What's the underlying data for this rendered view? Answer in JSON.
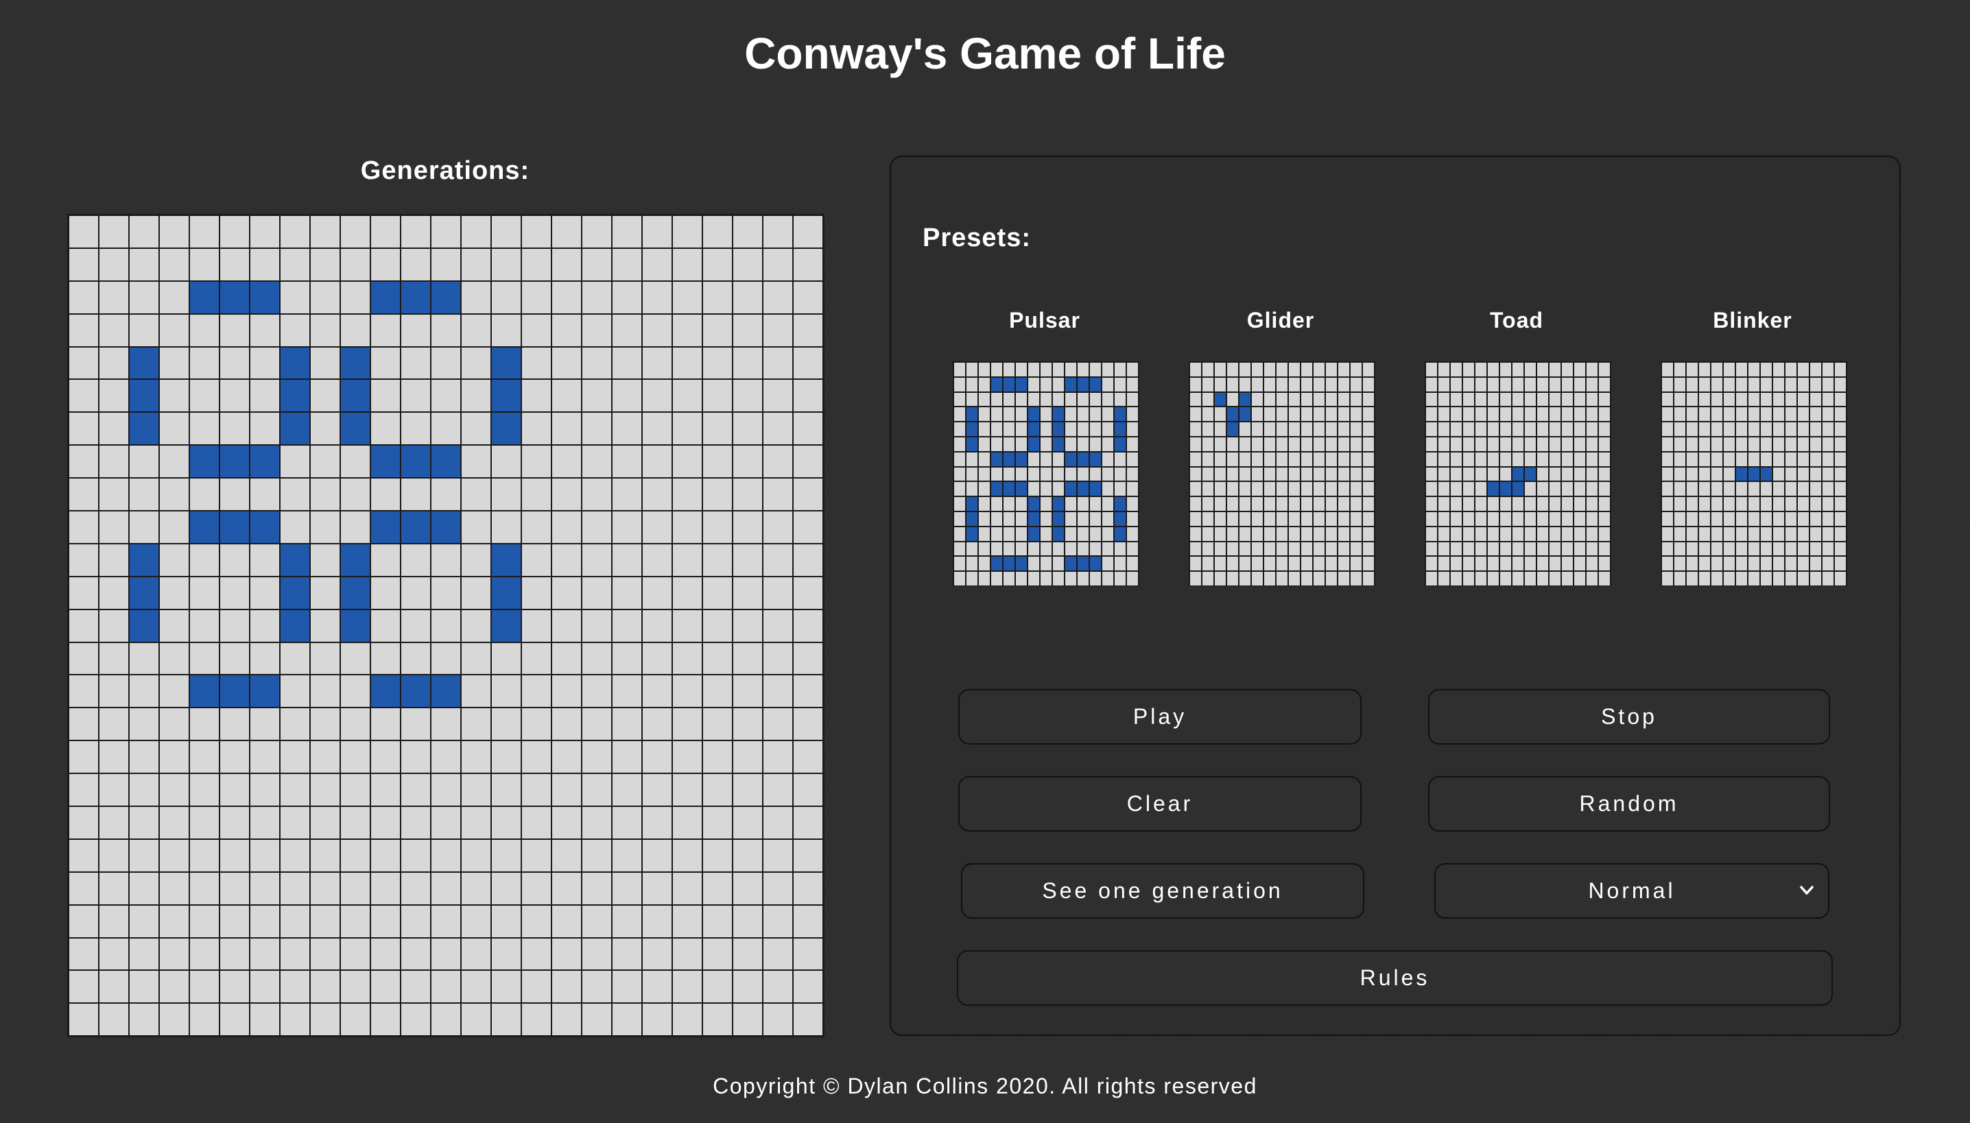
{
  "page": {
    "title": "Conway's Game of Life",
    "footer": "Copyright © Dylan Collins 2020. All rights reserved"
  },
  "board": {
    "label": "Generations:",
    "rows": 25,
    "cols": 25,
    "alive_cells": [
      [
        2,
        4
      ],
      [
        2,
        5
      ],
      [
        2,
        6
      ],
      [
        2,
        10
      ],
      [
        2,
        11
      ],
      [
        2,
        12
      ],
      [
        4,
        2
      ],
      [
        4,
        7
      ],
      [
        4,
        9
      ],
      [
        4,
        14
      ],
      [
        5,
        2
      ],
      [
        5,
        7
      ],
      [
        5,
        9
      ],
      [
        5,
        14
      ],
      [
        6,
        2
      ],
      [
        6,
        7
      ],
      [
        6,
        9
      ],
      [
        6,
        14
      ],
      [
        7,
        4
      ],
      [
        7,
        5
      ],
      [
        7,
        6
      ],
      [
        7,
        10
      ],
      [
        7,
        11
      ],
      [
        7,
        12
      ],
      [
        9,
        4
      ],
      [
        9,
        5
      ],
      [
        9,
        6
      ],
      [
        9,
        10
      ],
      [
        9,
        11
      ],
      [
        9,
        12
      ],
      [
        10,
        2
      ],
      [
        10,
        7
      ],
      [
        10,
        9
      ],
      [
        10,
        14
      ],
      [
        11,
        2
      ],
      [
        11,
        7
      ],
      [
        11,
        9
      ],
      [
        11,
        14
      ],
      [
        12,
        2
      ],
      [
        12,
        7
      ],
      [
        12,
        9
      ],
      [
        12,
        14
      ],
      [
        14,
        4
      ],
      [
        14,
        5
      ],
      [
        14,
        6
      ],
      [
        14,
        10
      ],
      [
        14,
        11
      ],
      [
        14,
        12
      ]
    ]
  },
  "presets": {
    "label": "Presets:",
    "items": [
      {
        "name": "Pulsar",
        "rows": 15,
        "cols": 15,
        "alive_cells": [
          [
            1,
            3
          ],
          [
            1,
            4
          ],
          [
            1,
            5
          ],
          [
            1,
            9
          ],
          [
            1,
            10
          ],
          [
            1,
            11
          ],
          [
            3,
            1
          ],
          [
            3,
            6
          ],
          [
            3,
            8
          ],
          [
            3,
            13
          ],
          [
            4,
            1
          ],
          [
            4,
            6
          ],
          [
            4,
            8
          ],
          [
            4,
            13
          ],
          [
            5,
            1
          ],
          [
            5,
            6
          ],
          [
            5,
            8
          ],
          [
            5,
            13
          ],
          [
            6,
            3
          ],
          [
            6,
            4
          ],
          [
            6,
            5
          ],
          [
            6,
            9
          ],
          [
            6,
            10
          ],
          [
            6,
            11
          ],
          [
            8,
            3
          ],
          [
            8,
            4
          ],
          [
            8,
            5
          ],
          [
            8,
            9
          ],
          [
            8,
            10
          ],
          [
            8,
            11
          ],
          [
            9,
            1
          ],
          [
            9,
            6
          ],
          [
            9,
            8
          ],
          [
            9,
            13
          ],
          [
            10,
            1
          ],
          [
            10,
            6
          ],
          [
            10,
            8
          ],
          [
            10,
            13
          ],
          [
            11,
            1
          ],
          [
            11,
            6
          ],
          [
            11,
            8
          ],
          [
            11,
            13
          ],
          [
            13,
            3
          ],
          [
            13,
            4
          ],
          [
            13,
            5
          ],
          [
            13,
            9
          ],
          [
            13,
            10
          ],
          [
            13,
            11
          ]
        ]
      },
      {
        "name": "Glider",
        "rows": 15,
        "cols": 15,
        "alive_cells": [
          [
            2,
            2
          ],
          [
            2,
            4
          ],
          [
            3,
            3
          ],
          [
            3,
            4
          ],
          [
            4,
            3
          ]
        ]
      },
      {
        "name": "Toad",
        "rows": 15,
        "cols": 15,
        "alive_cells": [
          [
            7,
            7
          ],
          [
            7,
            8
          ],
          [
            8,
            5
          ],
          [
            8,
            6
          ],
          [
            8,
            7
          ]
        ]
      },
      {
        "name": "Blinker",
        "rows": 15,
        "cols": 15,
        "alive_cells": [
          [
            7,
            6
          ],
          [
            7,
            7
          ],
          [
            7,
            8
          ]
        ]
      }
    ]
  },
  "controls": {
    "play": "Play",
    "stop": "Stop",
    "clear": "Clear",
    "random": "Random",
    "step": "See one generation",
    "speed_selected": "Normal",
    "rules": "Rules"
  },
  "colors": {
    "alive": "#2058ac",
    "dead": "#d8d8d8",
    "background": "#2f2f2f"
  },
  "icons": {
    "select_arrow": "chevron-down-icon"
  }
}
